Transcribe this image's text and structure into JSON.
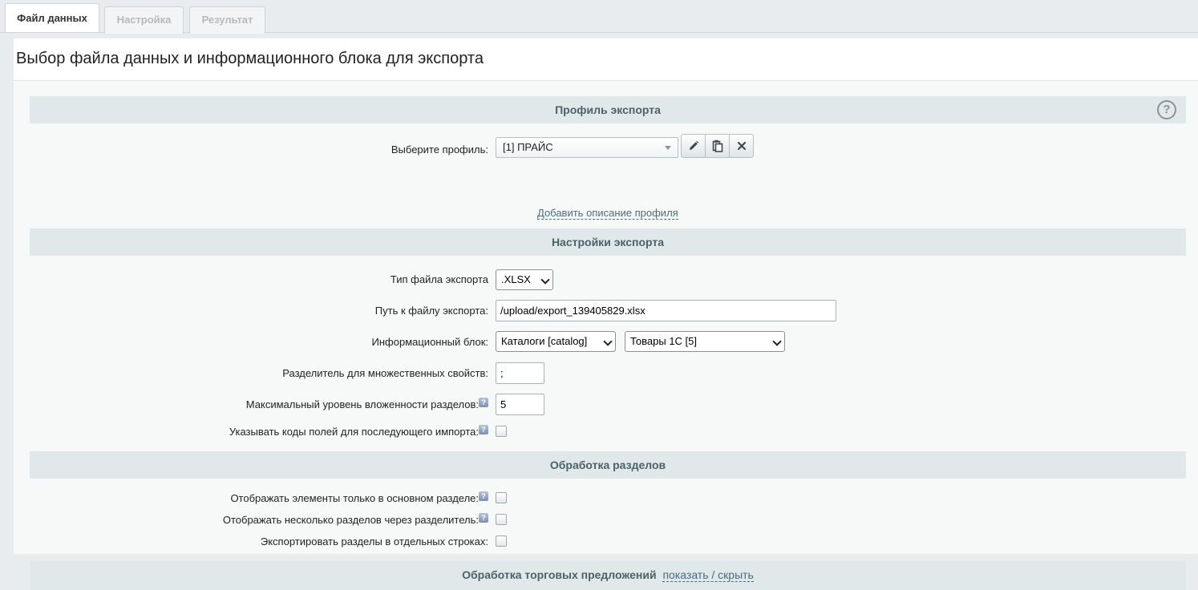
{
  "tabs": [
    {
      "label": "Файл данных",
      "active": true
    },
    {
      "label": "Настройка",
      "active": false
    },
    {
      "label": "Результат",
      "active": false
    }
  ],
  "page_title": "Выбор файла данных и информационного блока для экспорта",
  "sections": {
    "profile": {
      "title": "Профиль экспорта",
      "help_icon": "question-circle-icon",
      "select_label": "Выберите профиль:",
      "selected_profile": "[1] ПРАЙС",
      "buttons": [
        "edit-pencil-icon",
        "copy-icon",
        "delete-x-icon"
      ],
      "add_description_link": "Добавить описание профиля"
    },
    "export_settings": {
      "title": "Настройки экспорта",
      "file_type_label": "Тип файла экспорта",
      "file_type_value": ".XLSX",
      "path_label": "Путь к файлу экспорта:",
      "path_value": "/upload/export_139405829.xlsx",
      "iblock_label": "Информационный блок:",
      "iblock_type_value": "Каталоги [catalog]",
      "iblock_value": "Товары 1С [5]",
      "separator_label": "Разделитель для множественных свойств:",
      "separator_value": ";",
      "max_level_label": "Максимальный уровень вложенности разделов:",
      "max_level_value": "5",
      "field_codes_label": "Указывать коды полей для последующего импорта:",
      "field_codes_checked": false
    },
    "sections_processing": {
      "title": "Обработка разделов",
      "main_section_only_label": "Отображать элементы только в основном разделе:",
      "main_section_only_checked": false,
      "multiple_sections_label": "Отображать несколько разделов через разделитель:",
      "multiple_sections_checked": false,
      "separate_rows_label": "Экспортировать разделы в отдельных строках:",
      "separate_rows_checked": false
    },
    "offers": {
      "title": "Обработка торговых предложений",
      "toggle_link": "показать / скрыть"
    }
  },
  "hint_marker": "?",
  "colors": {
    "section_bg": "#e0e8ea",
    "section_text": "#4b6267",
    "link": "#4a6d7d",
    "background": "#e8ecee"
  }
}
